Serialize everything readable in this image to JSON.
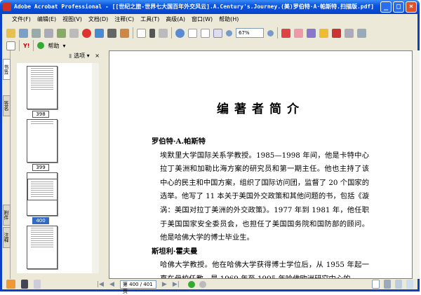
{
  "window": {
    "title": "Adobe Acrobat Professional - [[世纪之旅-世界七大国百年外交风云].A.Century's.Journey.(美)罗伯特·A·帕斯特.扫描版.pdf]"
  },
  "menu": [
    "文件(F)",
    "编辑(E)",
    "视图(V)",
    "文档(D)",
    "注释(C)",
    "工具(T)",
    "高级(A)",
    "窗口(W)",
    "帮助(H)"
  ],
  "toolbar": {
    "zoom": "67%",
    "help": "帮助"
  },
  "sidebar": {
    "options": "选项",
    "close": "×",
    "tabs": [
      "书签",
      "签名",
      "附件",
      "注释"
    ],
    "pages": [
      "398",
      "399",
      "400"
    ]
  },
  "document": {
    "heading": "编著者简介",
    "sections": [
      {
        "name": "罗伯特·A.帕斯特",
        "text": "埃默里大学国际关系学教授。1985—1998 年间，他是卡特中心拉丁美洲和加勒比海方案的研究员和第一期主任。他也主持了该中心的民主和中国方案，组织了国际访问团，监督了 20 个国家的选举。他写了 11 本关于美国外交政策和其他问题的书，包括《漩涡：美国对拉丁美洲的外交政策》。1977 年到 1981 年，他任职于美国国家安全委员会，也担任了美国国务院和国防部的顾问。他是哈佛大学的博士毕业生。"
      },
      {
        "name": "斯坦利·霍夫曼",
        "text": "哈佛大学教授。他在哈佛大学获得博士学位后，从 1955 年起一直在母校任教，是 1969 年至 1995 年哈佛欧洲研究中心的"
      }
    ]
  },
  "status": {
    "page": "第 400 / 401 页"
  }
}
